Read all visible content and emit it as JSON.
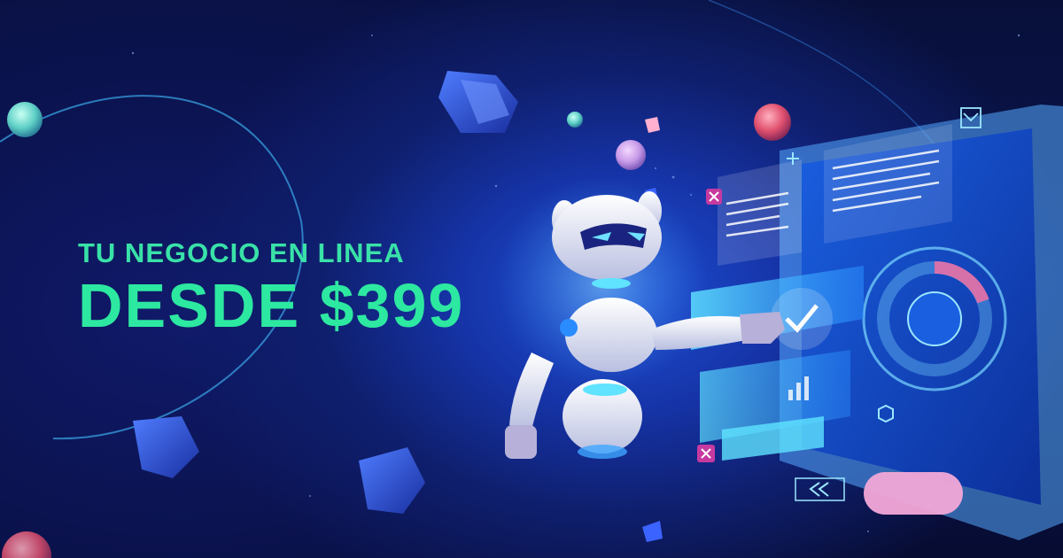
{
  "headline": {
    "line1": "TU NEGOCIO EN LINEA",
    "line2": "DESDE $399"
  },
  "colors": {
    "background": "#0a1550",
    "accent_green": "#2de8a0",
    "robot_body": "#dfe3f5",
    "glow_blue": "#3fa6ff",
    "sphere_pink": "#e0506e"
  },
  "illustration": {
    "robot": "robot-illustration",
    "dashboard": "holographic-dashboard",
    "icons": [
      "check-icon",
      "envelope-icon",
      "close-icon",
      "plus-icon",
      "rewind-icon",
      "bar-chart-icon",
      "hexagon-icon"
    ]
  }
}
